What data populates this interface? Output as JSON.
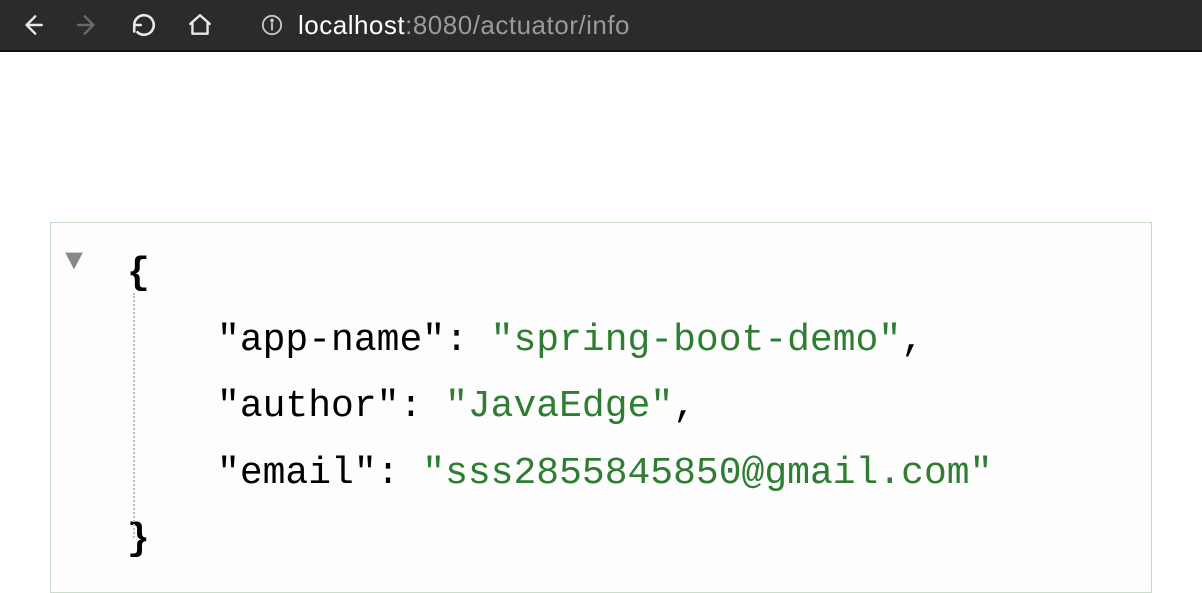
{
  "toolbar": {
    "url_host": "localhost",
    "url_port_path": ":8080/actuator/info"
  },
  "json": {
    "open_brace": "{",
    "close_brace": "}",
    "entries": [
      {
        "key": "app-name",
        "value": "spring-boot-demo",
        "comma": true
      },
      {
        "key": "author",
        "value": "JavaEdge",
        "comma": true
      },
      {
        "key": "email",
        "value": "sss2855845850@gmail.com",
        "comma": false
      }
    ]
  }
}
